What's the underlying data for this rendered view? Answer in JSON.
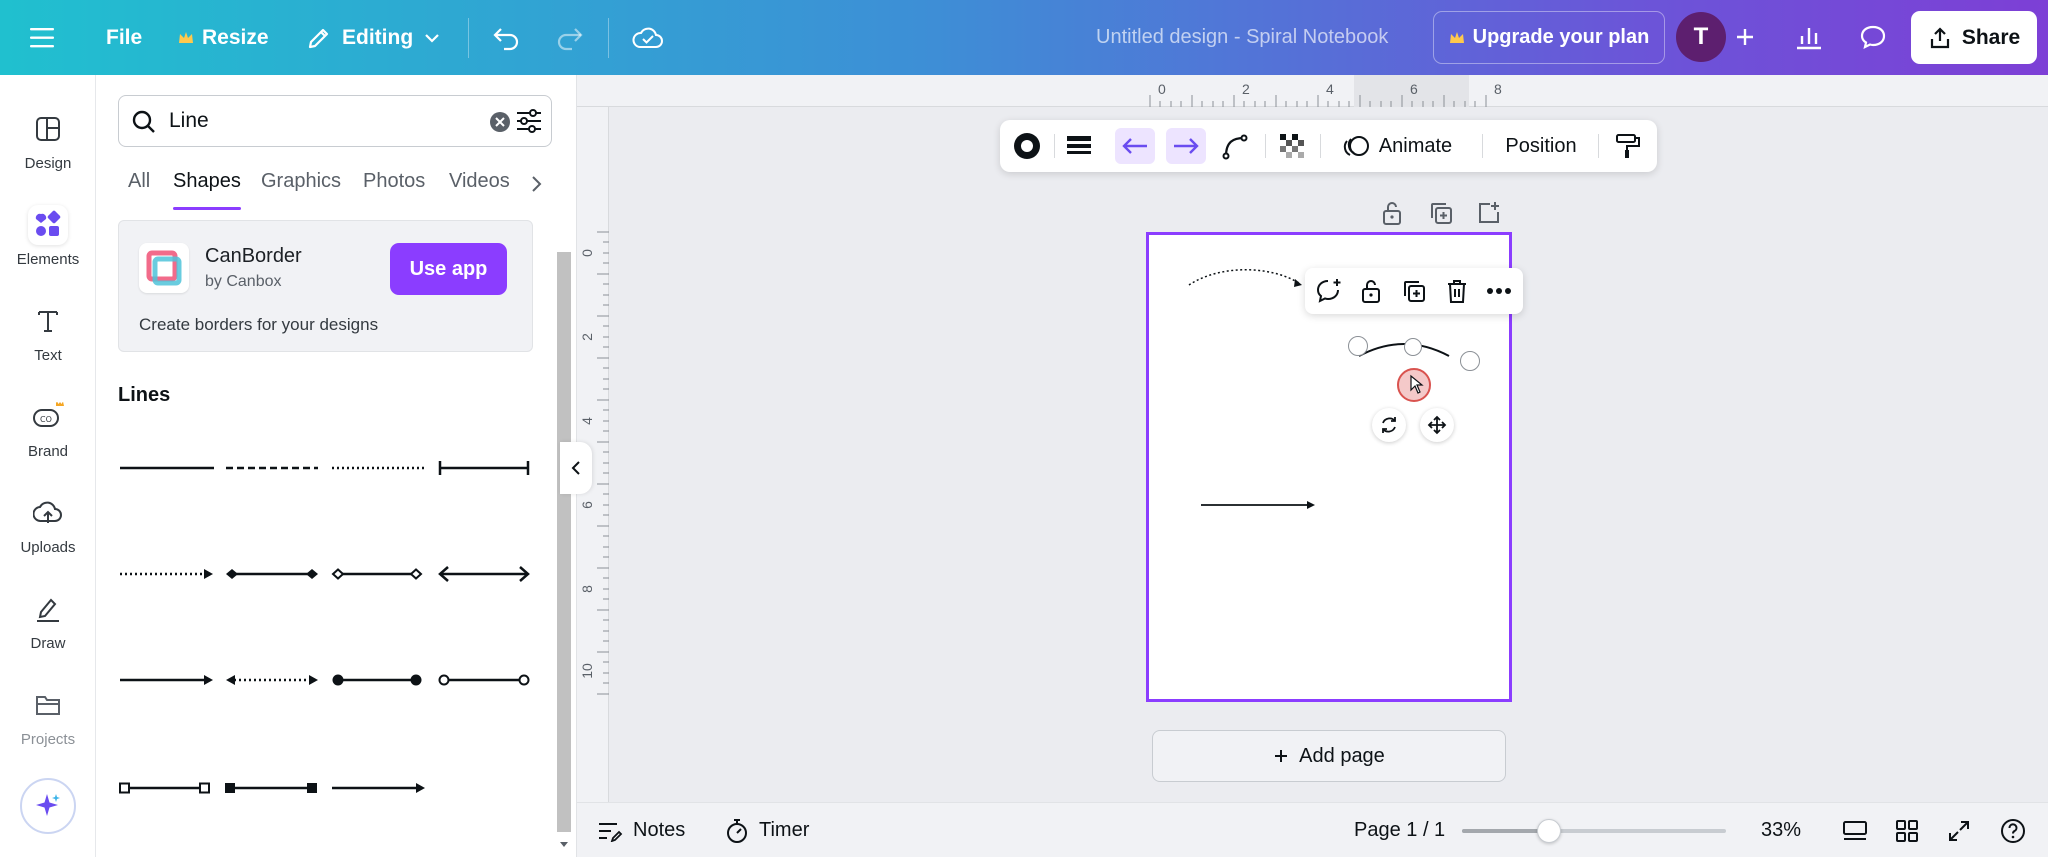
{
  "topbar": {
    "file_label": "File",
    "resize_label": "Resize",
    "editing_label": "Editing",
    "doc_title": "Untitled design - Spiral Notebook",
    "upgrade_label": "Upgrade your plan",
    "avatar_initial": "T",
    "share_label": "Share"
  },
  "rail": {
    "items": [
      {
        "label": "Design"
      },
      {
        "label": "Elements"
      },
      {
        "label": "Text"
      },
      {
        "label": "Brand"
      },
      {
        "label": "Uploads"
      },
      {
        "label": "Draw"
      },
      {
        "label": "Projects"
      }
    ]
  },
  "panel": {
    "search_value": "Line",
    "tabs": [
      "All",
      "Shapes",
      "Graphics",
      "Photos",
      "Videos"
    ],
    "active_tab": "Shapes",
    "app_card": {
      "name": "CanBorder",
      "by": "by Canbox",
      "button": "Use app",
      "description": "Create borders for your designs"
    },
    "section_title": "Lines"
  },
  "ruler": {
    "top": [
      "0",
      "2",
      "4",
      "6",
      "8"
    ],
    "left": [
      "0",
      "2",
      "4",
      "6",
      "8",
      "10"
    ]
  },
  "element_toolbar": {
    "animate_label": "Animate",
    "position_label": "Position"
  },
  "canvas": {
    "add_page_label": "Add page"
  },
  "bottombar": {
    "notes_label": "Notes",
    "timer_label": "Timer",
    "page_indicator": "Page 1 / 1",
    "zoom": "33%",
    "zoom_fraction": 0.33
  },
  "colors": {
    "accent": "#8b3dff",
    "avatar": "#5d1f6f"
  }
}
